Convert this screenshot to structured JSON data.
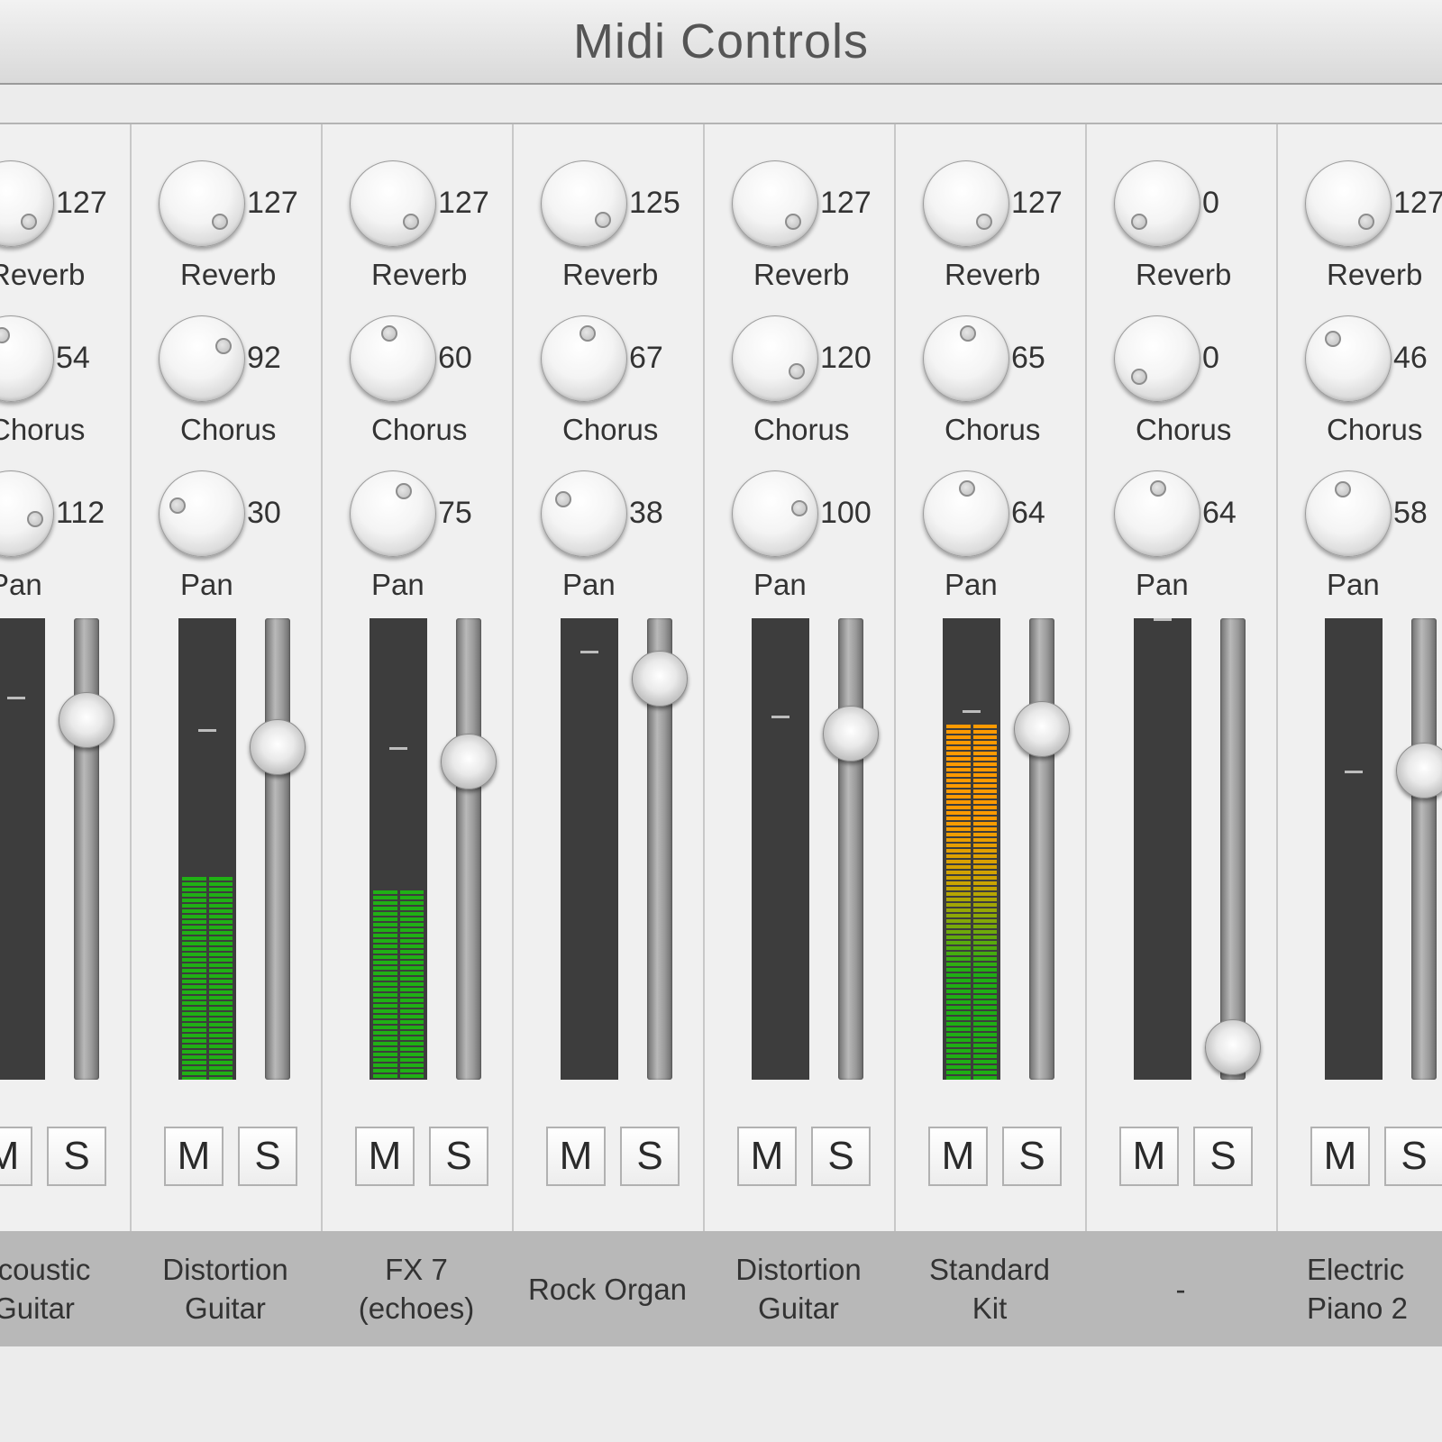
{
  "window": {
    "title": "Midi Controls"
  },
  "knob_labels": {
    "reverb": "Reverb",
    "chorus": "Chorus",
    "pan": "Pan"
  },
  "buttons": {
    "mute": "M",
    "solo": "S"
  },
  "channels": [
    {
      "name": "Acoustic\nGuitar",
      "reverb": "127",
      "chorus": "54",
      "pan": "112",
      "level": 0.0,
      "volume": 0.78,
      "peak": 0.83,
      "reverb_label": "Reverb",
      "chorus_label": "Chorus",
      "pan_label": "Pan"
    },
    {
      "name": "Distortion\nGuitar",
      "reverb": "127",
      "chorus": "92",
      "pan": "30",
      "level": 0.44,
      "volume": 0.72,
      "peak": 0.76
    },
    {
      "name": "FX 7\n(echoes)",
      "reverb": "127",
      "chorus": "60",
      "pan": "75",
      "level": 0.41,
      "volume": 0.69,
      "peak": 0.72
    },
    {
      "name": "Rock Organ",
      "reverb": "125",
      "chorus": "67",
      "pan": "38",
      "level": 0.0,
      "volume": 0.87,
      "peak": 0.93
    },
    {
      "name": "Distortion\nGuitar",
      "reverb": "127",
      "chorus": "120",
      "pan": "100",
      "level": 0.0,
      "volume": 0.75,
      "peak": 0.79
    },
    {
      "name": "Standard\nKit",
      "reverb": "127",
      "chorus": "65",
      "pan": "64",
      "level": 0.77,
      "volume": 0.76,
      "peak": 0.8
    },
    {
      "name": "-",
      "reverb": "0",
      "chorus": "0",
      "pan": "64",
      "level": 0.0,
      "volume": 0.07,
      "peak": 1.0
    },
    {
      "name": "Electric\nPiano 2",
      "reverb": "127",
      "chorus": "46",
      "pan": "58",
      "level": 0.0,
      "volume": 0.67,
      "peak": 0.67
    }
  ],
  "colors": {
    "meter_green": "#20b015",
    "meter_orange": "#ff9a00",
    "meter_bg": "#3d3d3d",
    "name_bar": "#b8b8b8"
  }
}
